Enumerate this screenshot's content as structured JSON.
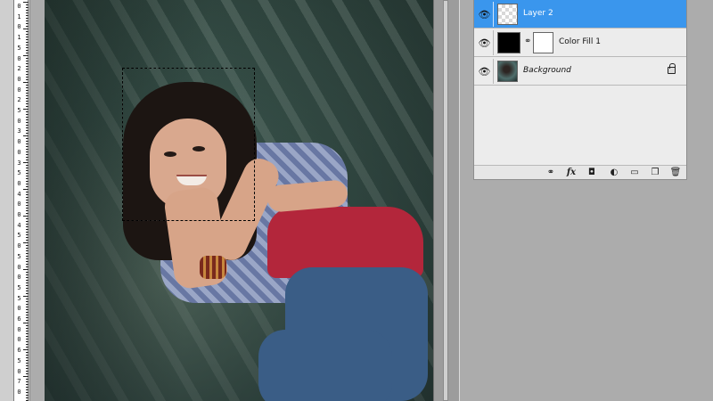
{
  "ruler": {
    "labels": [
      "0",
      "1",
      "0",
      "1",
      "5",
      "0",
      "2",
      "0",
      "0",
      "2",
      "5",
      "0",
      "3",
      "0",
      "0",
      "3",
      "5",
      "0",
      "4",
      "0",
      "0",
      "4",
      "5",
      "0",
      "5",
      "0",
      "0",
      "5",
      "5",
      "0",
      "6",
      "0",
      "0",
      "6",
      "5",
      "0",
      "7",
      "0"
    ]
  },
  "layers_panel": {
    "layers": [
      {
        "name": "Layer 2",
        "thumb": "transparent",
        "selected": true
      },
      {
        "name": "Color Fill 1",
        "thumb": "color-fill",
        "selected": false
      },
      {
        "name": "Background",
        "thumb": "photo",
        "selected": false,
        "locked": true
      }
    ],
    "footer_icons": [
      "link-icon",
      "fx-icon",
      "mask-icon",
      "adjustment-icon",
      "folder-icon",
      "new-layer-icon",
      "trash-icon"
    ],
    "footer_fx_label": "fx"
  },
  "colors": {
    "selection_highlight": "#3a96ed",
    "panel_bg": "#ececec",
    "workspace": "#acacac"
  }
}
